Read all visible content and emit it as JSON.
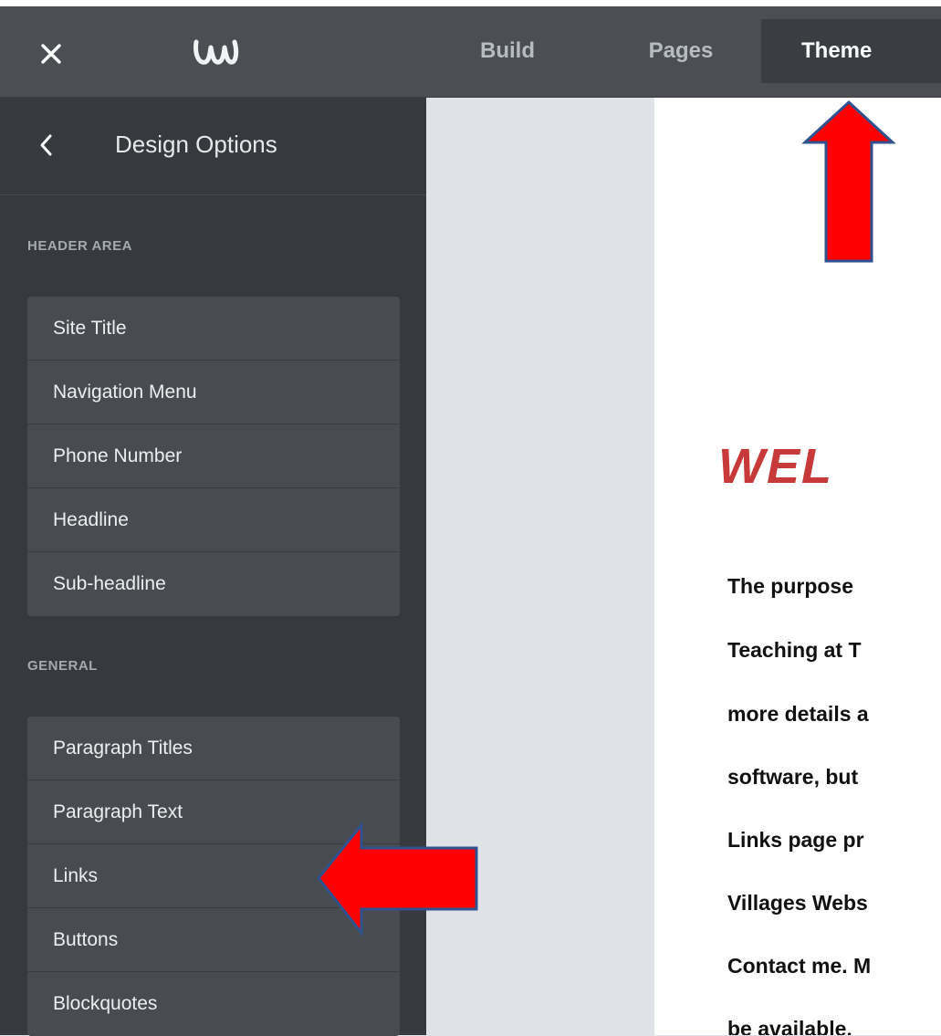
{
  "topbar": {
    "tabs": [
      {
        "label": "Build"
      },
      {
        "label": "Pages"
      },
      {
        "label": "Theme"
      }
    ]
  },
  "sidebar": {
    "title": "Design Options",
    "sections": [
      {
        "label": "HEADER AREA",
        "items": [
          "Site Title",
          "Navigation Menu",
          "Phone Number",
          "Headline",
          "Sub-headline"
        ]
      },
      {
        "label": "GENERAL",
        "items": [
          "Paragraph Titles",
          "Paragraph Text",
          "Links",
          "Buttons",
          "Blockquotes"
        ]
      }
    ]
  },
  "preview": {
    "heading": "WEL",
    "paragraph_lines": [
      "The purpose",
      "Teaching at T",
      "more details a",
      "software, but",
      "Links page pr",
      "Villages Webs",
      "Contact me. M",
      "be available."
    ]
  },
  "colors": {
    "topbar": "#4b4f54",
    "sidebar": "#363a3f",
    "option": "#484c51",
    "active_tab": "#3a3e43",
    "heading": "#c8393a",
    "arrow_fill": "#ff0000",
    "arrow_stroke": "#2f528f"
  }
}
